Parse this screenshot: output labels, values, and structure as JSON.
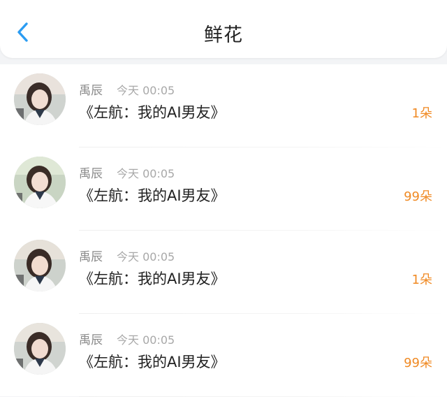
{
  "header": {
    "title": "鲜花",
    "back_icon": "chevron-left-icon",
    "accent_color": "#2b9cf2"
  },
  "items": [
    {
      "user": "禹辰",
      "time": "今天 00:05",
      "book": "《左航：我的AI男友》",
      "count": "1朵"
    },
    {
      "user": "禹辰",
      "time": "今天 00:05",
      "book": "《左航：我的AI男友》",
      "count": "99朵"
    },
    {
      "user": "禹辰",
      "time": "今天 00:05",
      "book": "《左航：我的AI男友》",
      "count": "1朵"
    },
    {
      "user": "禹辰",
      "time": "今天 00:05",
      "book": "《左航：我的AI男友》",
      "count": "99朵"
    }
  ],
  "colors": {
    "count": "#f08a24",
    "meta": "#8a8a8a"
  }
}
